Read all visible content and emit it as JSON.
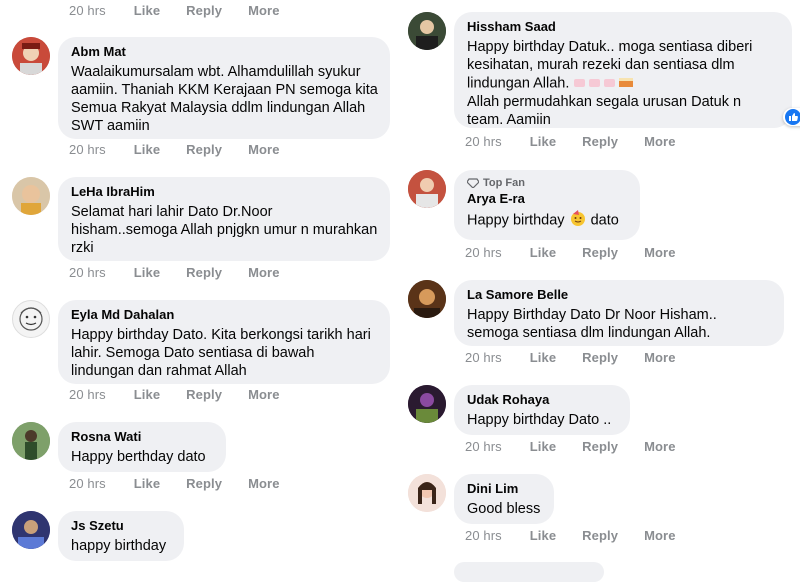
{
  "actions": {
    "like": "Like",
    "reply": "Reply",
    "more": "More"
  },
  "comments_left": [
    {
      "time": "20 hrs"
    },
    {
      "name": "Abm Mat",
      "text": "Waalaikumursalam wbt. Alhamdulillah syukur aamiin. Thaniah KKM Kerajaan PN semoga kita Semua Rakyat Malaysia ddlm lindungan Allah SWT aamiin",
      "time": "20 hrs"
    },
    {
      "name": "LeHa IbraHim",
      "text": "Selamat hari lahir Dato Dr.Noor hisham..semoga Allah pnjgkn umur n murahkan rzki",
      "time": "20 hrs"
    },
    {
      "name": "Eyla Md Dahalan",
      "text": "Happy birthday Dato. Kita berkongsi tarikh hari lahir. Semoga Dato sentiasa di bawah lindungan dan rahmat Allah",
      "time": "20 hrs"
    },
    {
      "name": "Rosna Wati",
      "text": "Happy berthday dato",
      "time": "20 hrs"
    },
    {
      "name": "Js Szetu",
      "text": "happy birthday"
    }
  ],
  "comments_right": [
    {
      "name": "Hissham Saad",
      "text": "Happy birthday Datuk.. moga sentiasa diberi kesihatan, murah rezeki dan sentiasa dlm lindungan Allah.",
      "text2": "Allah permudahkan segala urusan Datuk n team. Aamiin",
      "reaction_count": "1",
      "time": "20 hrs"
    },
    {
      "badge": "Top Fan",
      "name": "Arya E-ra",
      "text": "Happy birthday",
      "text_after": "dato",
      "time": "20 hrs"
    },
    {
      "name": "La Samore Belle",
      "text": "Happy Birthday Dato Dr Noor Hisham.. semoga sentiasa dlm lindungan Allah.",
      "time": "20 hrs"
    },
    {
      "name": "Udak Rohaya",
      "text": "Happy birthday Dato ..",
      "time": "20 hrs"
    },
    {
      "name": "Dini Lim",
      "text": "Good bless",
      "time": "20 hrs"
    }
  ]
}
